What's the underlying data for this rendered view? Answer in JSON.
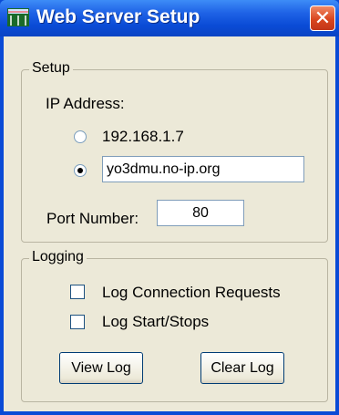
{
  "window": {
    "title": "Web Server Setup",
    "close_glyph": "✕"
  },
  "setup": {
    "group_label": "Setup",
    "ip_label": "IP Address:",
    "ip_option_local": "192.168.1.7",
    "ip_option_host_value": "yo3dmu.no-ip.org",
    "selected_option": "host",
    "port_label": "Port Number:",
    "port_value": "80"
  },
  "logging": {
    "group_label": "Logging",
    "log_connection_label": "Log Connection Requests",
    "log_connection_checked": false,
    "log_startstop_label": "Log Start/Stops",
    "log_startstop_checked": false,
    "view_log_label": "View Log",
    "clear_log_label": "Clear Log"
  },
  "colors": {
    "titlebar": "#0a4bd6",
    "dialog_face": "#ece9d8",
    "close_button": "#d9461f"
  }
}
